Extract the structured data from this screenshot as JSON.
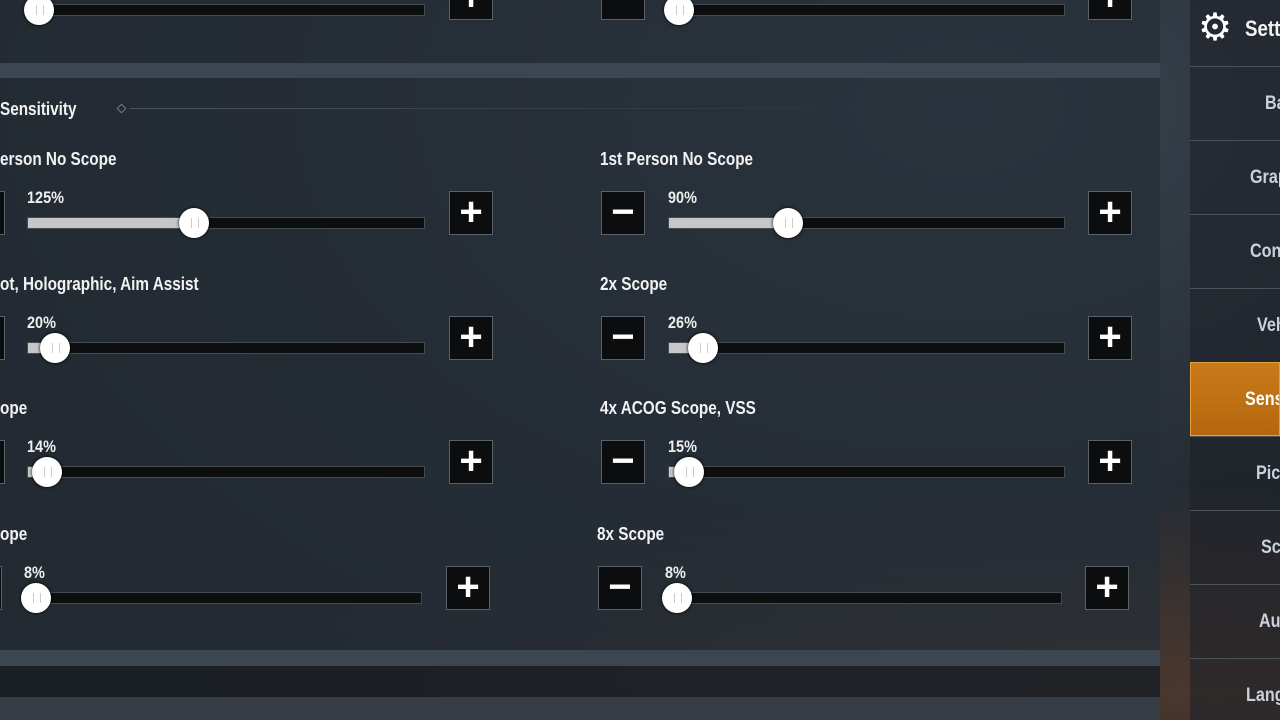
{
  "accent_color": "#c97a1a",
  "header": {
    "title": "Sett",
    "icon": "gear-icon"
  },
  "sidebar": {
    "items": [
      {
        "label": "Ba",
        "active": false
      },
      {
        "label": "Grap",
        "active": false
      },
      {
        "label": "Con",
        "active": false
      },
      {
        "label": "Veh",
        "active": false
      },
      {
        "label": "Sens",
        "active": true
      },
      {
        "label": "Pic",
        "active": false
      },
      {
        "label": "Sc",
        "active": false
      },
      {
        "label": "Au",
        "active": false
      },
      {
        "label": "Lang",
        "active": false
      }
    ]
  },
  "section": {
    "title": "Sensitivity"
  },
  "slider_max": 300,
  "top_row": {
    "left_value": 0,
    "right_value": 0
  },
  "sliders": [
    {
      "label": "erson No Scope",
      "value_text": "125%",
      "value": 125
    },
    {
      "label": "1st Person No Scope",
      "value_text": "90%",
      "value": 90
    },
    {
      "label": "ot, Holographic, Aim Assist",
      "value_text": "20%",
      "value": 20
    },
    {
      "label": "2x Scope",
      "value_text": "26%",
      "value": 26
    },
    {
      "label": "ope",
      "value_text": "14%",
      "value": 14
    },
    {
      "label": "4x ACOG Scope, VSS",
      "value_text": "15%",
      "value": 15
    },
    {
      "label": "ope",
      "value_text": "8%",
      "value": 8
    },
    {
      "label": "8x Scope",
      "value_text": "8%",
      "value": 8
    }
  ],
  "buttons": {
    "minus": "−",
    "plus": "+"
  }
}
